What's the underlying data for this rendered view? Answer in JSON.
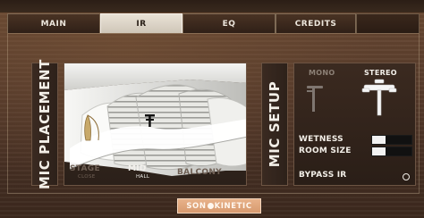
{
  "tabs": [
    {
      "label": "MAIN",
      "active": false
    },
    {
      "label": "IR",
      "active": true
    },
    {
      "label": "EQ",
      "active": false
    },
    {
      "label": "CREDITS",
      "active": false
    }
  ],
  "mic_placement": {
    "title": "MIC PLACEMENT",
    "positions": [
      {
        "label": "STAGE",
        "sub": "CLOSE",
        "selected": false
      },
      {
        "label": "MID",
        "sub": "HALL",
        "selected": true
      },
      {
        "label": "BALCONY",
        "sub": "",
        "selected": false
      }
    ],
    "icons": {
      "stage": "harp-icon",
      "mic_position": "mic-position-marker-icon",
      "hall": "concert-hall-seating-illustration"
    }
  },
  "mic_setup": {
    "title": "MIC SETUP",
    "modes": [
      {
        "label": "MONO",
        "selected": false,
        "icon": "mono-mic-icon"
      },
      {
        "label": "STEREO",
        "selected": true,
        "icon": "stereo-mic-icon"
      }
    ],
    "params": [
      {
        "label": "WETNESS",
        "value": 0.35
      },
      {
        "label": "ROOM SIZE",
        "value": 0.35
      }
    ],
    "bypass": {
      "label": "BYPASS IR",
      "checked": false
    }
  },
  "brand": {
    "left": "SON",
    "right": "KINETIC"
  },
  "colors": {
    "accent": "#d79a6f",
    "text": "#f3efe8",
    "inactive_text": "#6f6055",
    "slider_fill": "#f2f2f2"
  }
}
